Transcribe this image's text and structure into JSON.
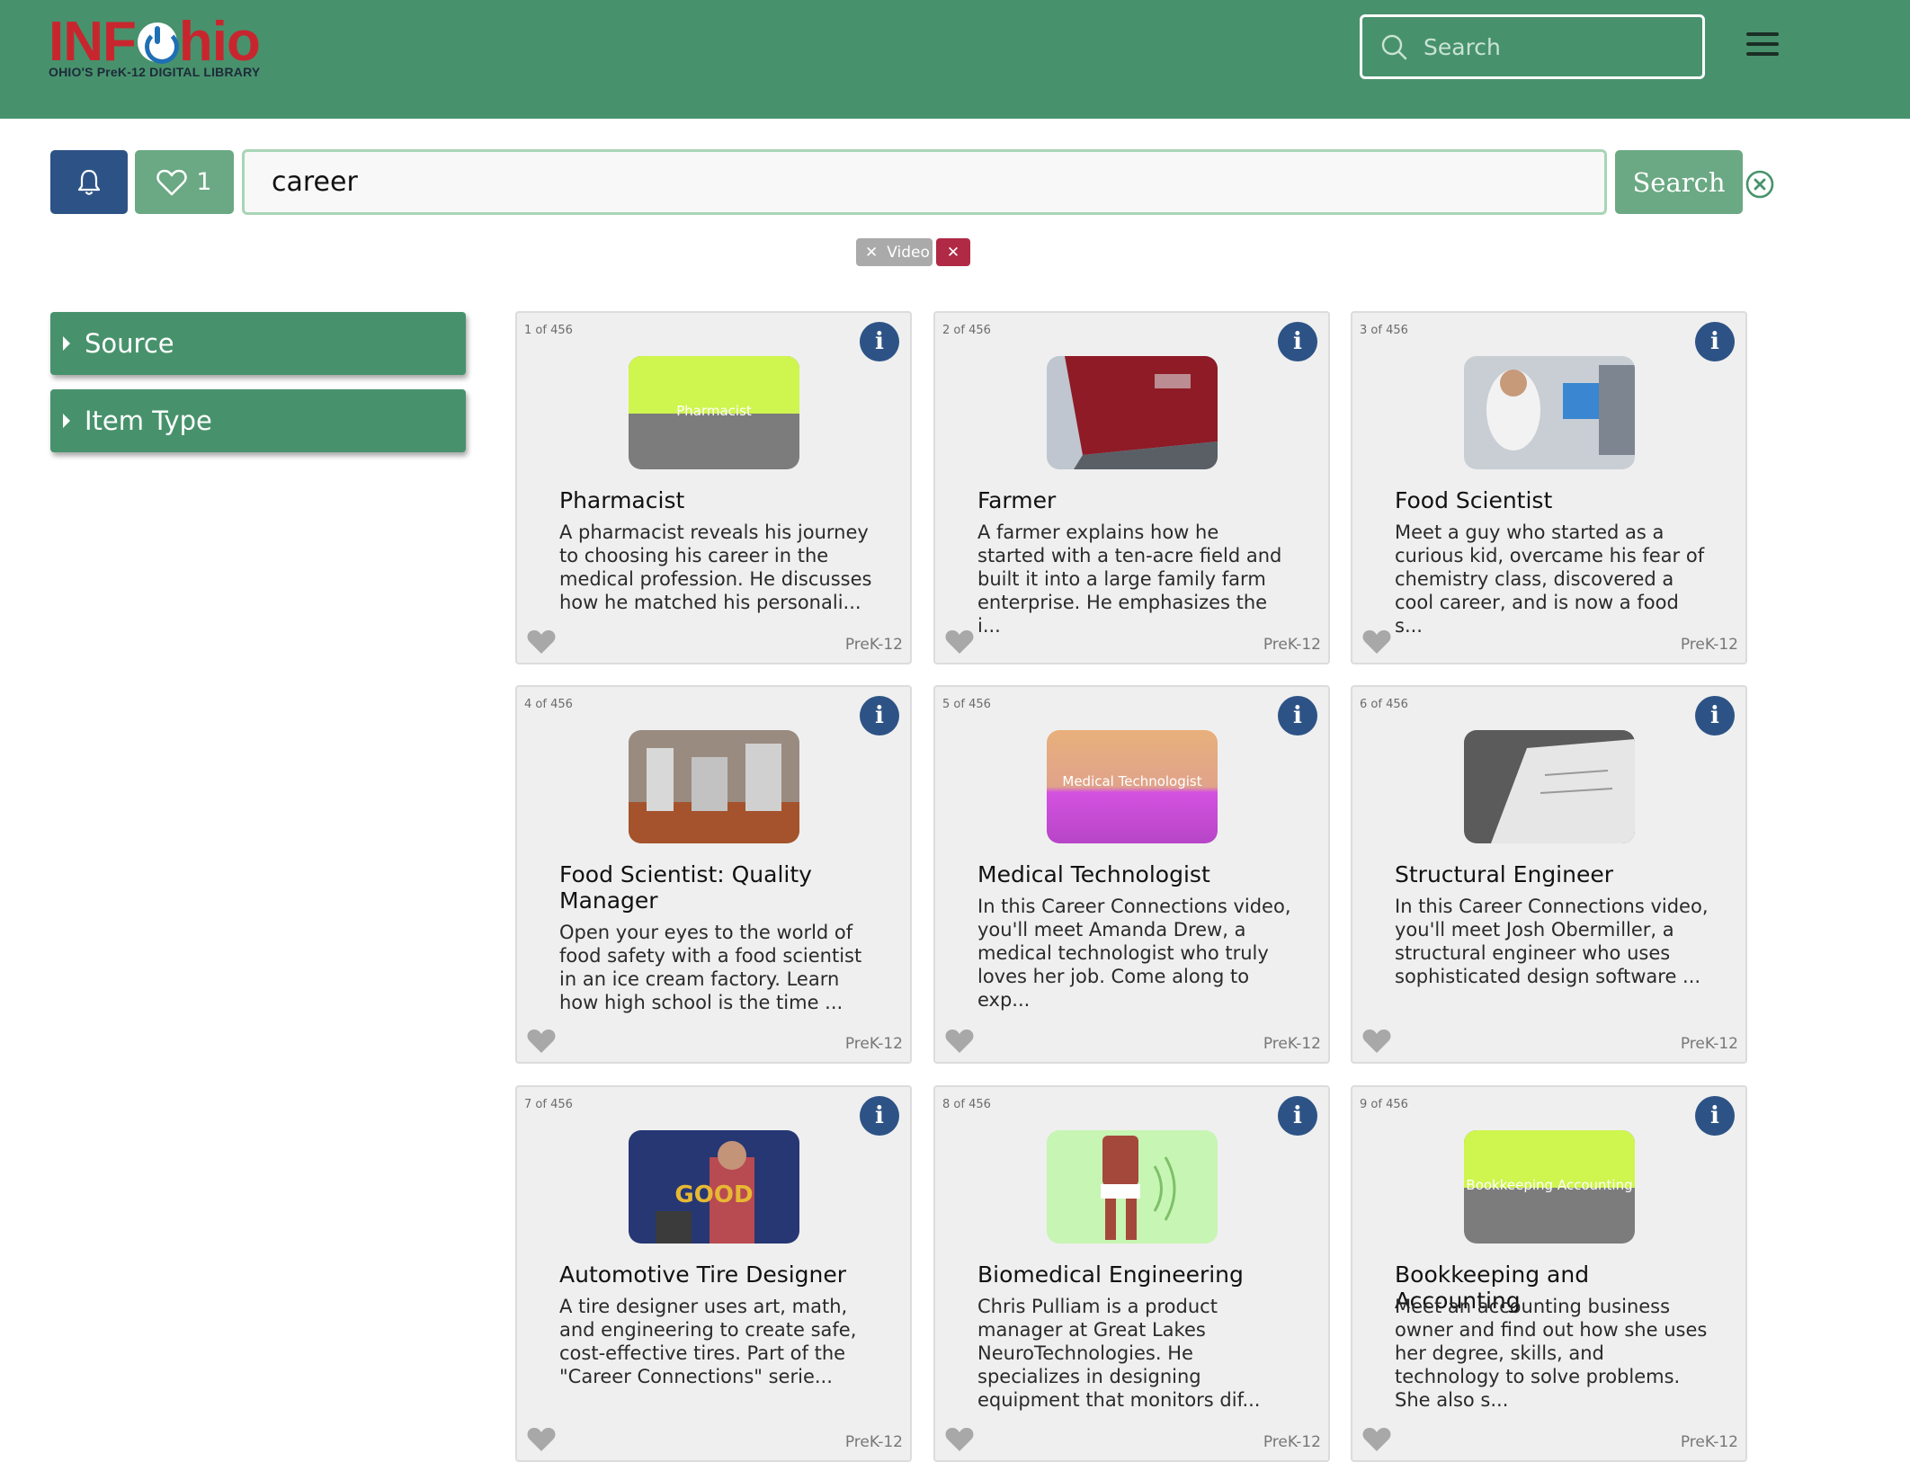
{
  "header": {
    "logo_text_left": "INF",
    "logo_text_right": "hio",
    "logo_subtitle": "OHIO'S PreK-12 DIGITAL LIBRARY",
    "search_placeholder": "Search",
    "colors": {
      "header_bg": "#47926c",
      "logo_red": "#c8262e",
      "power_blue": "#1f6fb5"
    }
  },
  "toolbar": {
    "favorites_count": "1",
    "query": "career",
    "search_label": "Search",
    "chips": [
      {
        "label": "Video"
      }
    ],
    "colors": {
      "bell_bg": "#2d5386",
      "green_btn": "#6aa983",
      "chip_remove": "#b02a45"
    }
  },
  "sidebar": {
    "facets": [
      {
        "label": "Source"
      },
      {
        "label": "Item Type"
      }
    ]
  },
  "results": {
    "total": 456,
    "items": [
      {
        "count": "1 of 456",
        "title": "Pharmacist",
        "desc": "A pharmacist reveals his journey to choosing his career in the medical profession. He discusses how he matched his personali...",
        "grade": "PreK-12",
        "thumb_text": "Pharmacist",
        "thumb_kind": "yellow-gray"
      },
      {
        "count": "2 of 456",
        "title": "Farmer",
        "desc": "A farmer explains how he started with a ten-acre field and built it into a large family farm enterprise. He emphasizes the i...",
        "grade": "PreK-12",
        "thumb_text": "",
        "thumb_kind": "truck"
      },
      {
        "count": "3 of 456",
        "title": "Food Scientist",
        "desc": "Meet a guy who started as a curious kid, overcame his fear of chemistry class, discovered a cool career, and is now a food s...",
        "grade": "PreK-12",
        "thumb_text": "",
        "thumb_kind": "lab"
      },
      {
        "count": "4 of 456",
        "title": "Food Scientist: Quality Manager",
        "desc": "Open your eyes to the world of food safety with a food scientist in an ice cream factory. Learn how high school is the time ...",
        "grade": "PreK-12",
        "thumb_text": "",
        "thumb_kind": "factory"
      },
      {
        "count": "5 of 456",
        "title": "Medical Technologist",
        "desc": "In this Career Connections video, you'll meet Amanda Drew, a medical technologist who truly loves her job. Come along to exp...",
        "grade": "PreK-12",
        "thumb_text": "Medical Technologist",
        "thumb_kind": "orange-purple"
      },
      {
        "count": "6 of 456",
        "title": "Structural Engineer",
        "desc": "In this Career Connections video, you'll meet Josh Obermiller, a structural engineer who uses sophisticated design software ...",
        "grade": "PreK-12",
        "thumb_text": "",
        "thumb_kind": "blueprint"
      },
      {
        "count": "7 of 456",
        "title": "Automotive Tire Designer",
        "desc": "A tire designer uses art, math, and engineering to create safe, cost-effective tires. Part of the \"Career Connections\" serie...",
        "grade": "PreK-12",
        "thumb_text": "GOOD",
        "thumb_kind": "goodyear"
      },
      {
        "count": "8 of 456",
        "title": "Biomedical Engineering",
        "desc": "Chris Pulliam is a product manager at Great Lakes NeuroTechnologies. He specializes in designing equipment that monitors dif...",
        "grade": "PreK-12",
        "thumb_text": "",
        "thumb_kind": "figure"
      },
      {
        "count": "9 of 456",
        "title": "Bookkeeping and Accounting",
        "desc": "Meet an accounting business owner and find out how she uses her degree, skills, and technology to solve problems. She also s...",
        "grade": "PreK-12",
        "thumb_text": "Bookkeeping Accounting",
        "thumb_kind": "yellow-gray"
      }
    ]
  }
}
